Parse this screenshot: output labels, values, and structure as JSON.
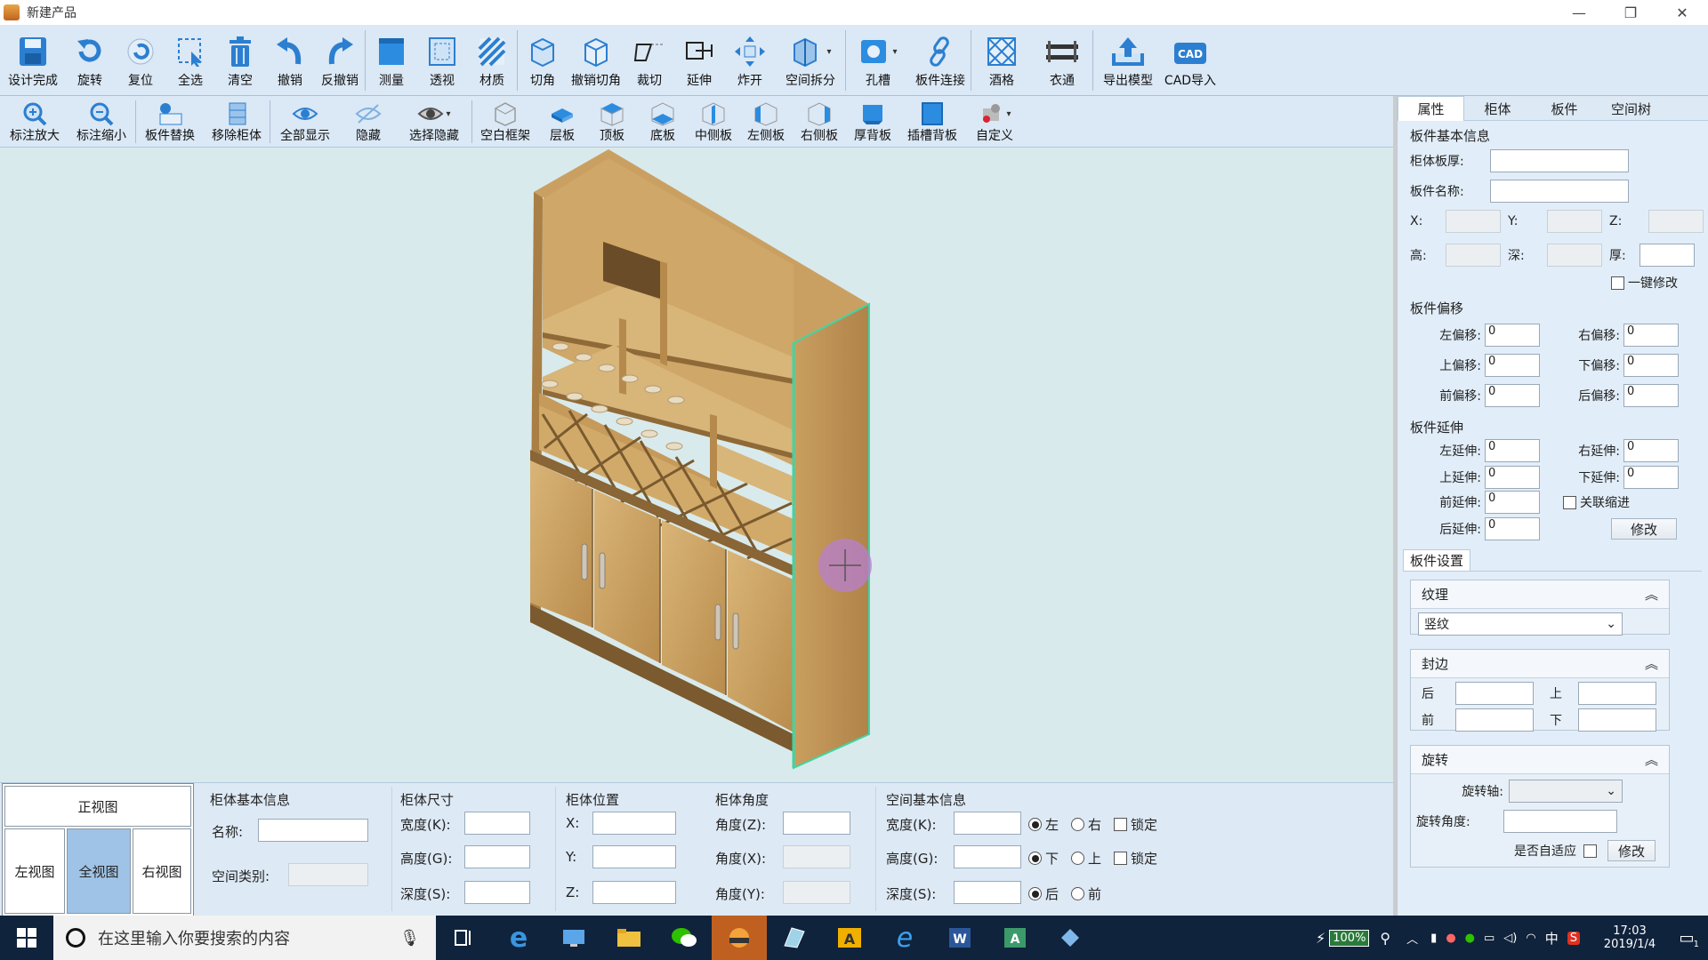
{
  "window": {
    "title": "新建产品"
  },
  "toolbar1": [
    {
      "name": "design-complete-button",
      "icon": "save-icon",
      "label": "设计完成"
    },
    {
      "name": "rotate-button",
      "icon": "rotate-icon",
      "label": "旋转"
    },
    {
      "name": "reset-button",
      "icon": "reset-icon",
      "label": "复位"
    },
    {
      "name": "select-all-button",
      "icon": "select-all-icon",
      "label": "全选"
    },
    {
      "name": "clear-button",
      "icon": "trash-icon",
      "label": "清空"
    },
    {
      "name": "undo-button",
      "icon": "undo-icon",
      "label": "撤销"
    },
    {
      "name": "redo-button",
      "icon": "redo-icon",
      "label": "反撤销"
    },
    {
      "name": "measure-button",
      "icon": "measure-icon",
      "label": "测量"
    },
    {
      "name": "perspective-button",
      "icon": "perspective-icon",
      "label": "透视"
    },
    {
      "name": "material-button",
      "icon": "material-icon",
      "label": "材质"
    },
    {
      "name": "bevel-button",
      "icon": "bevel-icon",
      "label": "切角"
    },
    {
      "name": "undo-bevel-button",
      "icon": "undo-bevel-icon",
      "label": "撤销切角"
    },
    {
      "name": "cut-button",
      "icon": "cut-icon",
      "label": "裁切"
    },
    {
      "name": "extend-button",
      "icon": "extend-icon",
      "label": "延伸"
    },
    {
      "name": "explode-button",
      "icon": "explode-icon",
      "label": "炸开"
    },
    {
      "name": "space-split-button",
      "icon": "space-split-icon",
      "label": "空间拆分"
    },
    {
      "name": "hole-slot-button",
      "icon": "hole-slot-icon",
      "label": "孔槽"
    },
    {
      "name": "board-connect-button",
      "icon": "link-icon",
      "label": "板件连接"
    },
    {
      "name": "wine-grid-button",
      "icon": "wine-grid-icon",
      "label": "酒格"
    },
    {
      "name": "clothes-rail-button",
      "icon": "clothes-rail-icon",
      "label": "衣通"
    },
    {
      "name": "export-model-button",
      "icon": "export-icon",
      "label": "导出模型"
    },
    {
      "name": "cad-import-button",
      "icon": "cad-icon",
      "label": "CAD导入"
    }
  ],
  "toolbar2": [
    {
      "name": "zoom-in-label-button",
      "icon": "zoom-in-icon",
      "label": "标注放大"
    },
    {
      "name": "zoom-out-label-button",
      "icon": "zoom-out-icon",
      "label": "标注缩小"
    },
    {
      "name": "replace-board-button",
      "icon": "replace-board-icon",
      "label": "板件替换"
    },
    {
      "name": "remove-cabinet-button",
      "icon": "remove-cabinet-icon",
      "label": "移除柜体"
    },
    {
      "name": "show-all-button",
      "icon": "eye-icon",
      "label": "全部显示"
    },
    {
      "name": "hide-button",
      "icon": "eye-hidden-icon",
      "label": "隐藏"
    },
    {
      "name": "select-hide-button",
      "icon": "eye-select-icon",
      "label": "选择隐藏"
    },
    {
      "name": "blank-frame-button",
      "icon": "frame-icon",
      "label": "空白框架"
    },
    {
      "name": "shelf-button",
      "icon": "shelf-icon",
      "label": "层板"
    },
    {
      "name": "top-board-button",
      "icon": "top-board-icon",
      "label": "顶板"
    },
    {
      "name": "bottom-board-button",
      "icon": "bottom-board-icon",
      "label": "底板"
    },
    {
      "name": "middle-side-button",
      "icon": "middle-side-icon",
      "label": "中侧板"
    },
    {
      "name": "left-side-button",
      "icon": "left-side-icon",
      "label": "左侧板"
    },
    {
      "name": "right-side-button",
      "icon": "right-side-icon",
      "label": "右侧板"
    },
    {
      "name": "thick-back-button",
      "icon": "thick-back-icon",
      "label": "厚背板"
    },
    {
      "name": "slot-back-button",
      "icon": "slot-back-icon",
      "label": "插槽背板"
    },
    {
      "name": "custom-button",
      "icon": "custom-icon",
      "label": "自定义"
    }
  ],
  "right_panel": {
    "tabs": [
      "属性",
      "柜体",
      "板件",
      "空间树"
    ],
    "basic_title": "板件基本信息",
    "thickness_label": "柜体板厚:",
    "board_name_label": "板件名称:",
    "x_label": "X:",
    "y_label": "Y:",
    "z_label": "Z:",
    "h_label": "高:",
    "d_label": "深:",
    "t_label": "厚:",
    "one_key": "一键修改",
    "offset_title": "板件偏移",
    "offsets": [
      {
        "l1": "左偏移:",
        "v1": "0",
        "l2": "右偏移:",
        "v2": "0"
      },
      {
        "l1": "上偏移:",
        "v1": "0",
        "l2": "下偏移:",
        "v2": "0"
      },
      {
        "l1": "前偏移:",
        "v1": "0",
        "l2": "后偏移:",
        "v2": "0"
      }
    ],
    "extend_title": "板件延伸",
    "extends": [
      {
        "l1": "左延伸:",
        "v1": "0",
        "l2": "右延伸:",
        "v2": "0"
      },
      {
        "l1": "上延伸:",
        "v1": "0",
        "l2": "下延伸:",
        "v2": "0"
      }
    ],
    "front_extend_label": "前延伸:",
    "front_extend_value": "0",
    "linked_shrink": "关联缩进",
    "back_extend_label": "后延伸:",
    "back_extend_value": "0",
    "modify": "修改",
    "settings_title": "板件设置",
    "texture_title": "纹理",
    "texture_value": "竖纹",
    "edge_title": "封边",
    "edge_back": "后",
    "edge_top": "上",
    "edge_front": "前",
    "edge_bottom": "下",
    "rotate_title": "旋转",
    "rotate_axis_label": "旋转轴:",
    "rotate_angle_label": "旋转角度:",
    "auto_fit_label": "是否自适应",
    "rotate_modify": "修改"
  },
  "bottom": {
    "views": {
      "front": "正视图",
      "left": "左视图",
      "all": "全视图",
      "right": "右视图"
    },
    "basic_title": "柜体基本信息",
    "name_label": "名称:",
    "space_type_label": "空间类别:",
    "size_title": "柜体尺寸",
    "width_label": "宽度(K):",
    "height_label": "高度(G):",
    "depth_label": "深度(S):",
    "pos_title": "柜体位置",
    "x_label": "X:",
    "y_label": "Y:",
    "z_label": "Z:",
    "angle_title": "柜体角度",
    "angle_z": "角度(Z):",
    "angle_x": "角度(X):",
    "angle_y": "角度(Y):",
    "space_title": "空间基本信息",
    "s_width": "宽度(K):",
    "s_height": "高度(G):",
    "s_depth": "深度(S):",
    "left": "左",
    "right": "右",
    "lock": "锁定",
    "down": "下",
    "up": "上",
    "back": "后",
    "front": "前"
  },
  "taskbar": {
    "search_placeholder": "在这里输入你要搜索的内容",
    "battery": "100%",
    "ime": "中",
    "time": "17:03",
    "date": "2019/1/4",
    "notifications": "1"
  }
}
